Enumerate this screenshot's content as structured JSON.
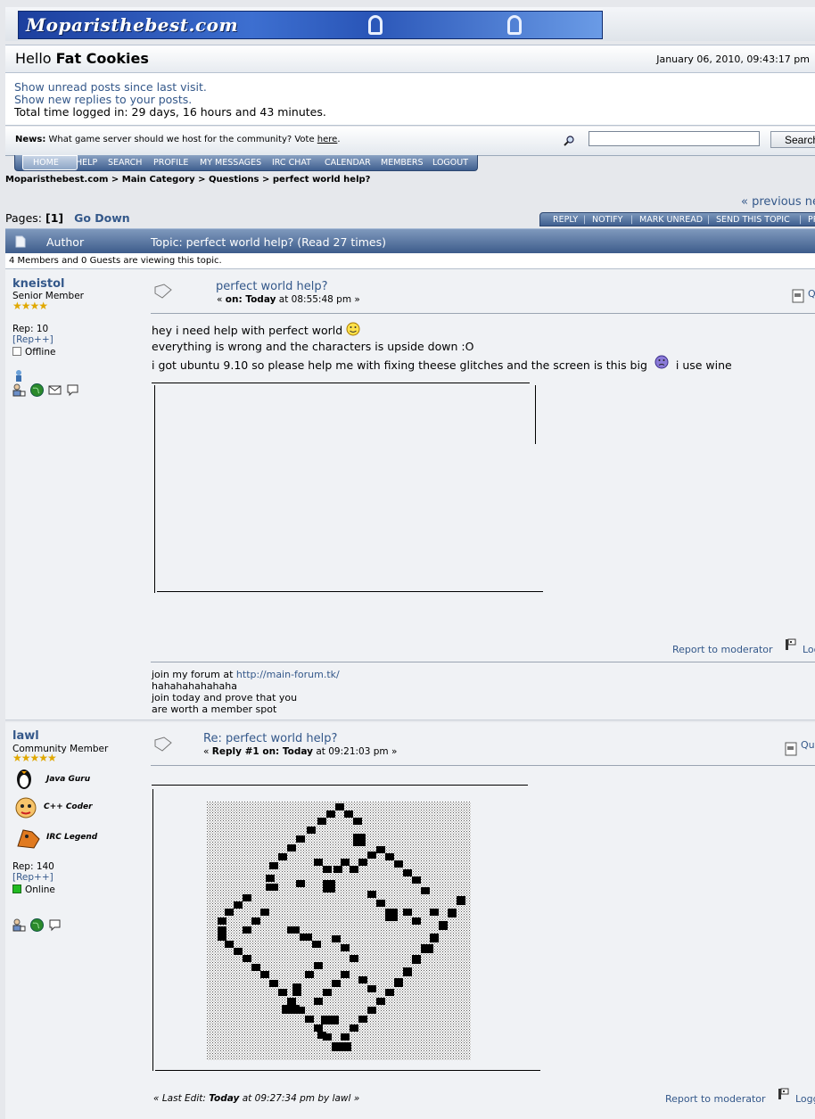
{
  "site": {
    "logo_text": "Moparisthebest.com"
  },
  "header": {
    "greeting": "Hello",
    "username": "Fat Cookies",
    "datetime": "January 06, 2010, 09:43:17 pm"
  },
  "userbox": {
    "unread_link": "Show unread posts since last visit.",
    "replies_link": "Show new replies to your posts.",
    "time_logged": "Total time logged in: 29 days, 16 hours and 43 minutes."
  },
  "news": {
    "label": "News:",
    "text": "What game server should we host for the community? Vote",
    "link": "here",
    "end": "."
  },
  "search": {
    "value": "",
    "button_label": "Search"
  },
  "menu": [
    "HOME",
    "HELP",
    "SEARCH",
    "PROFILE",
    "MY MESSAGES",
    "IRC CHAT",
    "CALENDAR",
    "MEMBERS",
    "LOGOUT"
  ],
  "breadcrumb": [
    "Moparisthebest.com",
    "Main Category",
    "Questions",
    "perfect world help?"
  ],
  "breadcrumb_sep": ">",
  "prev_next": "« previous next »",
  "pages": {
    "label": "Pages:",
    "current": "[1]",
    "go_down": "Go Down"
  },
  "topic_buttons": [
    "REPLY",
    "NOTIFY",
    "MARK UNREAD",
    "SEND THIS TOPIC",
    "PRINT"
  ],
  "table": {
    "author_header": "Author",
    "topic_header": "Topic: perfect world help?  (Read 27 times)",
    "viewing": "4 Members and 0 Guests are viewing this topic."
  },
  "posts": [
    {
      "username": "kneistol",
      "member_title": "Senior Member",
      "stars": "★★★★",
      "rep": "Rep: 10",
      "rep_link": "[Rep++]",
      "status": "Offline",
      "subject": "perfect world help?",
      "meta_prefix": "«",
      "meta_on": "on: Today",
      "meta_time": "at 08:55:48 pm",
      "meta_suffix": "»",
      "quote_label": "Quote",
      "body": [
        "hey i need help with perfect world",
        "everything is wrong and the characters is upside down :O",
        "i got ubuntu 9.10 so please help me with fixing theese glitches and the screen is this big",
        "i use wine"
      ],
      "report": "Report to moderator",
      "logged": "Logged",
      "signature": {
        "line1": "join my forum at",
        "url": "http://main-forum.tk/",
        "line2": "hahahahahahaha",
        "line3": "join today and prove that you",
        "line4": "are worth a member spot"
      }
    },
    {
      "username": "lawl",
      "member_title": "Community Member",
      "stars": "★★★★★",
      "badges": [
        "Java Guru",
        "C++ Coder",
        "IRC Legend"
      ],
      "rep": "Rep: 140",
      "rep_link": "[Rep++]",
      "status": "Online",
      "subject": "Re: perfect world help?",
      "meta_prefix": "«",
      "meta_on": "Reply #1 on: Today",
      "meta_time": "at 09:21:03 pm",
      "meta_suffix": "»",
      "quote_label": "Quote",
      "last_edit_prefix": "« Last Edit:",
      "last_edit_when": "Today",
      "last_edit_rest": "at 09:27:34 pm by lawl",
      "last_edit_suffix": "»",
      "report": "Report to moderator",
      "logged": "Logged"
    }
  ],
  "colors": {
    "link": "#34588a",
    "header_blue": "#3d5c8b",
    "online": "#22bb22",
    "star": "#e0a800"
  }
}
